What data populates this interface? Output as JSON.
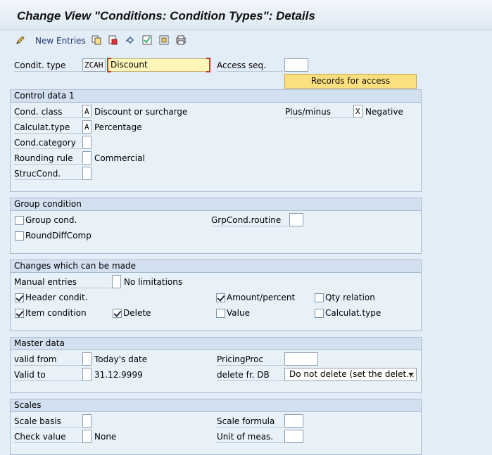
{
  "title": "Change View \"Conditions: Condition Types\": Details",
  "toolbar": {
    "new_entries": "New Entries"
  },
  "header": {
    "condit_type_label": "Condit. type",
    "condit_type_code": "ZCAH",
    "condit_type_desc": "Discount",
    "access_seq_label": "Access seq.",
    "access_seq_value": "",
    "records_button": "Records for access"
  },
  "control_data": {
    "title": "Control data 1",
    "cond_class_label": "Cond. class",
    "cond_class_value": "A",
    "cond_class_text": "Discount or surcharge",
    "plus_minus_label": "Plus/minus",
    "plus_minus_value": "X",
    "plus_minus_text": "Negative",
    "calc_type_label": "Calculat.type",
    "calc_type_value": "A",
    "calc_type_text": "Percentage",
    "cond_category_label": "Cond.category",
    "cond_category_value": "",
    "rounding_rule_label": "Rounding rule",
    "rounding_rule_value": "",
    "rounding_rule_text": "Commercial",
    "struc_cond_label": "StrucCond.",
    "struc_cond_value": ""
  },
  "group_condition": {
    "title": "Group condition",
    "group_cond_label": "Group cond.",
    "group_cond_checked": false,
    "grpcond_routine_label": "GrpCond.routine",
    "grpcond_routine_value": "",
    "round_diff_label": "RoundDiffComp",
    "round_diff_checked": false
  },
  "changes": {
    "title": "Changes which can be made",
    "manual_entries_label": "Manual entries",
    "manual_entries_value": "",
    "manual_entries_text": "No limitations",
    "header_condit_label": "Header condit.",
    "header_condit_checked": true,
    "amount_percent_label": "Amount/percent",
    "amount_percent_checked": true,
    "qty_relation_label": "Qty relation",
    "qty_relation_checked": false,
    "item_condition_label": "Item condition",
    "item_condition_checked": true,
    "delete_label": "Delete",
    "delete_checked": true,
    "value_label": "Value",
    "value_checked": false,
    "calc_type_label": "Calculat.type",
    "calc_type_checked": false
  },
  "master_data": {
    "title": "Master data",
    "valid_from_label": "valid from",
    "valid_from_value": "",
    "valid_from_text": "Today's date",
    "pricing_proc_label": "PricingProc",
    "pricing_proc_value": "",
    "valid_to_label": "Valid to",
    "valid_to_value": "",
    "valid_to_text": "31.12.9999",
    "delete_db_label": "delete fr. DB",
    "delete_db_value": "Do not delete (set the delet..."
  },
  "scales": {
    "title": "Scales",
    "scale_basis_label": "Scale basis",
    "scale_basis_value": "",
    "scale_formula_label": "Scale formula",
    "scale_formula_value": "",
    "check_value_label": "Check value",
    "check_value_value": "",
    "check_value_text": "None",
    "unit_meas_label": "Unit of meas.",
    "unit_meas_value": ""
  }
}
